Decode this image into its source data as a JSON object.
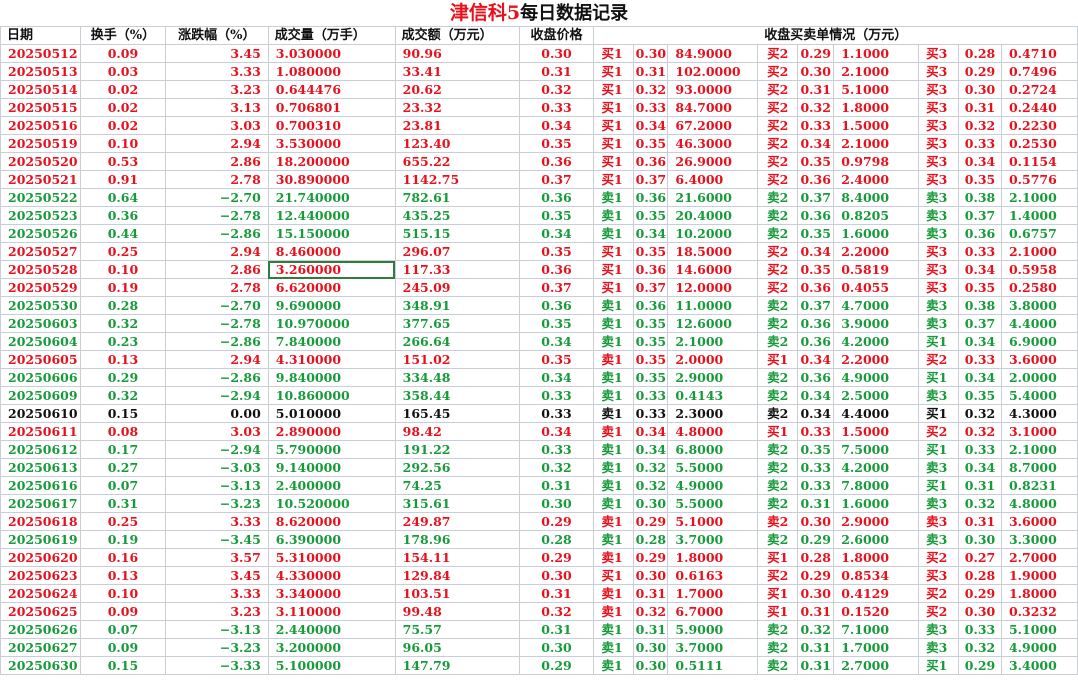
{
  "title": {
    "brand": "津信科5",
    "rest": "每日数据记录"
  },
  "headers": {
    "date": "日期",
    "turnover": "换手（%）",
    "change": "涨跌幅（%）",
    "volume": "成交量（万手）",
    "amount": "成交额（万元）",
    "close": "收盘价格",
    "orders": "收盘买卖单情况（万元）"
  },
  "colors": {
    "up": "#e8101c",
    "down": "#169a3a",
    "flat": "#111111",
    "grid": "#c9ced6"
  },
  "rows": [
    {
      "d": "20250512",
      "t": "0.09",
      "c": "3.45",
      "v": "3.030000",
      "a": "90.96",
      "p": "0.30",
      "s": "up",
      "o": [
        [
          "买1",
          "0.30",
          "84.9000"
        ],
        [
          "买2",
          "0.29",
          "1.1000"
        ],
        [
          "买3",
          "0.28",
          "0.4710"
        ]
      ]
    },
    {
      "d": "20250513",
      "t": "0.03",
      "c": "3.33",
      "v": "1.080000",
      "a": "33.41",
      "p": "0.31",
      "s": "up",
      "o": [
        [
          "买1",
          "0.31",
          "102.0000"
        ],
        [
          "买2",
          "0.30",
          "2.1000"
        ],
        [
          "买3",
          "0.29",
          "0.7496"
        ]
      ]
    },
    {
      "d": "20250514",
      "t": "0.02",
      "c": "3.23",
      "v": "0.644476",
      "a": "20.62",
      "p": "0.32",
      "s": "up",
      "o": [
        [
          "买1",
          "0.32",
          "93.0000"
        ],
        [
          "买2",
          "0.31",
          "5.1000"
        ],
        [
          "买3",
          "0.30",
          "0.2724"
        ]
      ]
    },
    {
      "d": "20250515",
      "t": "0.02",
      "c": "3.13",
      "v": "0.706801",
      "a": "23.32",
      "p": "0.33",
      "s": "up",
      "o": [
        [
          "买1",
          "0.33",
          "84.7000"
        ],
        [
          "买2",
          "0.32",
          "1.8000"
        ],
        [
          "买3",
          "0.31",
          "0.2440"
        ]
      ]
    },
    {
      "d": "20250516",
      "t": "0.02",
      "c": "3.03",
      "v": "0.700310",
      "a": "23.81",
      "p": "0.34",
      "s": "up",
      "o": [
        [
          "买1",
          "0.34",
          "67.2000"
        ],
        [
          "买2",
          "0.33",
          "1.5000"
        ],
        [
          "买3",
          "0.32",
          "0.2230"
        ]
      ]
    },
    {
      "d": "20250519",
      "t": "0.10",
      "c": "2.94",
      "v": "3.530000",
      "a": "123.40",
      "p": "0.35",
      "s": "up",
      "o": [
        [
          "买1",
          "0.35",
          "46.3000"
        ],
        [
          "买2",
          "0.34",
          "2.1000"
        ],
        [
          "买3",
          "0.33",
          "0.2530"
        ]
      ]
    },
    {
      "d": "20250520",
      "t": "0.53",
      "c": "2.86",
      "v": "18.200000",
      "a": "655.22",
      "p": "0.36",
      "s": "up",
      "o": [
        [
          "买1",
          "0.36",
          "26.9000"
        ],
        [
          "买2",
          "0.35",
          "0.9798"
        ],
        [
          "买3",
          "0.34",
          "0.1154"
        ]
      ]
    },
    {
      "d": "20250521",
      "t": "0.91",
      "c": "2.78",
      "v": "30.890000",
      "a": "1142.75",
      "p": "0.37",
      "s": "up",
      "o": [
        [
          "买1",
          "0.37",
          "6.4000"
        ],
        [
          "买2",
          "0.36",
          "2.4000"
        ],
        [
          "买3",
          "0.35",
          "0.5776"
        ]
      ]
    },
    {
      "d": "20250522",
      "t": "0.64",
      "c": "−2.70",
      "v": "21.740000",
      "a": "782.61",
      "p": "0.36",
      "s": "down",
      "o": [
        [
          "卖1",
          "0.36",
          "21.6000"
        ],
        [
          "卖2",
          "0.37",
          "8.4000"
        ],
        [
          "卖3",
          "0.38",
          "2.1000"
        ]
      ]
    },
    {
      "d": "20250523",
      "t": "0.36",
      "c": "−2.78",
      "v": "12.440000",
      "a": "435.25",
      "p": "0.35",
      "s": "down",
      "o": [
        [
          "卖1",
          "0.35",
          "20.4000"
        ],
        [
          "卖2",
          "0.36",
          "0.8205"
        ],
        [
          "卖3",
          "0.37",
          "1.4000"
        ]
      ]
    },
    {
      "d": "20250526",
      "t": "0.44",
      "c": "−2.86",
      "v": "15.150000",
      "a": "515.15",
      "p": "0.34",
      "s": "down",
      "o": [
        [
          "卖1",
          "0.34",
          "10.2000"
        ],
        [
          "卖2",
          "0.35",
          "1.6000"
        ],
        [
          "卖3",
          "0.36",
          "0.6757"
        ]
      ]
    },
    {
      "d": "20250527",
      "t": "0.25",
      "c": "2.94",
      "v": "8.460000",
      "a": "296.07",
      "p": "0.35",
      "s": "up",
      "o": [
        [
          "买1",
          "0.35",
          "18.5000"
        ],
        [
          "买2",
          "0.34",
          "2.2000"
        ],
        [
          "买3",
          "0.33",
          "2.1000"
        ]
      ]
    },
    {
      "d": "20250528",
      "t": "0.10",
      "c": "2.86",
      "v": "3.260000",
      "a": "117.33",
      "p": "0.36",
      "s": "up",
      "sel": true,
      "o": [
        [
          "买1",
          "0.36",
          "14.6000"
        ],
        [
          "买2",
          "0.35",
          "0.5819"
        ],
        [
          "买3",
          "0.34",
          "0.5958"
        ]
      ]
    },
    {
      "d": "20250529",
      "t": "0.19",
      "c": "2.78",
      "v": "6.620000",
      "a": "245.09",
      "p": "0.37",
      "s": "up",
      "o": [
        [
          "买1",
          "0.37",
          "12.0000"
        ],
        [
          "买2",
          "0.36",
          "0.4055"
        ],
        [
          "买3",
          "0.35",
          "0.2580"
        ]
      ]
    },
    {
      "d": "20250530",
      "t": "0.28",
      "c": "−2.70",
      "v": "9.690000",
      "a": "348.91",
      "p": "0.36",
      "s": "down",
      "o": [
        [
          "卖1",
          "0.36",
          "11.0000"
        ],
        [
          "卖2",
          "0.37",
          "4.7000"
        ],
        [
          "卖3",
          "0.38",
          "3.8000"
        ]
      ]
    },
    {
      "d": "20250603",
      "t": "0.32",
      "c": "−2.78",
      "v": "10.970000",
      "a": "377.65",
      "p": "0.35",
      "s": "down",
      "o": [
        [
          "卖1",
          "0.35",
          "12.6000"
        ],
        [
          "卖2",
          "0.36",
          "3.9000"
        ],
        [
          "卖3",
          "0.37",
          "4.4000"
        ]
      ]
    },
    {
      "d": "20250604",
      "t": "0.23",
      "c": "−2.86",
      "v": "7.840000",
      "a": "266.64",
      "p": "0.34",
      "s": "down",
      "o": [
        [
          "卖1",
          "0.35",
          "2.1000"
        ],
        [
          "卖2",
          "0.36",
          "4.2000"
        ],
        [
          "买1",
          "0.34",
          "6.9000"
        ]
      ]
    },
    {
      "d": "20250605",
      "t": "0.13",
      "c": "2.94",
      "v": "4.310000",
      "a": "151.02",
      "p": "0.35",
      "s": "up",
      "o": [
        [
          "卖1",
          "0.35",
          "2.0000"
        ],
        [
          "买1",
          "0.34",
          "2.2000"
        ],
        [
          "买2",
          "0.33",
          "3.6000"
        ]
      ]
    },
    {
      "d": "20250606",
      "t": "0.29",
      "c": "−2.86",
      "v": "9.840000",
      "a": "334.48",
      "p": "0.34",
      "s": "down",
      "o": [
        [
          "卖1",
          "0.35",
          "2.9000"
        ],
        [
          "卖2",
          "0.36",
          "4.9000"
        ],
        [
          "买1",
          "0.34",
          "2.0000"
        ]
      ]
    },
    {
      "d": "20250609",
      "t": "0.32",
      "c": "−2.94",
      "v": "10.860000",
      "a": "358.44",
      "p": "0.33",
      "s": "down",
      "o": [
        [
          "卖1",
          "0.33",
          "0.4143"
        ],
        [
          "卖2",
          "0.34",
          "2.5000"
        ],
        [
          "卖3",
          "0.35",
          "5.4000"
        ]
      ]
    },
    {
      "d": "20250610",
      "t": "0.15",
      "c": "0.00",
      "v": "5.010000",
      "a": "165.45",
      "p": "0.33",
      "s": "flat",
      "o": [
        [
          "卖1",
          "0.33",
          "2.3000"
        ],
        [
          "卖2",
          "0.34",
          "4.4000"
        ],
        [
          "买1",
          "0.32",
          "4.3000"
        ]
      ]
    },
    {
      "d": "20250611",
      "t": "0.08",
      "c": "3.03",
      "v": "2.890000",
      "a": "98.42",
      "p": "0.34",
      "s": "up",
      "o": [
        [
          "卖1",
          "0.34",
          "4.8000"
        ],
        [
          "买1",
          "0.33",
          "1.5000"
        ],
        [
          "买2",
          "0.32",
          "3.1000"
        ]
      ]
    },
    {
      "d": "20250612",
      "t": "0.17",
      "c": "−2.94",
      "v": "5.790000",
      "a": "191.22",
      "p": "0.33",
      "s": "down",
      "o": [
        [
          "卖1",
          "0.34",
          "6.8000"
        ],
        [
          "卖2",
          "0.35",
          "7.5000"
        ],
        [
          "买1",
          "0.33",
          "2.1000"
        ]
      ]
    },
    {
      "d": "20250613",
      "t": "0.27",
      "c": "−3.03",
      "v": "9.140000",
      "a": "292.56",
      "p": "0.32",
      "s": "down",
      "o": [
        [
          "卖1",
          "0.32",
          "5.5000"
        ],
        [
          "卖2",
          "0.33",
          "4.2000"
        ],
        [
          "卖3",
          "0.34",
          "8.7000"
        ]
      ]
    },
    {
      "d": "20250616",
      "t": "0.07",
      "c": "−3.13",
      "v": "2.400000",
      "a": "74.25",
      "p": "0.31",
      "s": "down",
      "o": [
        [
          "卖1",
          "0.32",
          "4.9000"
        ],
        [
          "卖2",
          "0.33",
          "7.8000"
        ],
        [
          "买1",
          "0.31",
          "0.8231"
        ]
      ]
    },
    {
      "d": "20250617",
      "t": "0.31",
      "c": "−3.23",
      "v": "10.520000",
      "a": "315.61",
      "p": "0.30",
      "s": "down",
      "o": [
        [
          "卖1",
          "0.30",
          "5.5000"
        ],
        [
          "卖2",
          "0.31",
          "1.6000"
        ],
        [
          "卖3",
          "0.32",
          "4.8000"
        ]
      ]
    },
    {
      "d": "20250618",
      "t": "0.25",
      "c": "3.33",
      "v": "8.620000",
      "a": "249.87",
      "p": "0.29",
      "s": "up",
      "o": [
        [
          "卖1",
          "0.29",
          "5.1000"
        ],
        [
          "卖2",
          "0.30",
          "2.9000"
        ],
        [
          "卖3",
          "0.31",
          "3.6000"
        ]
      ]
    },
    {
      "d": "20250619",
      "t": "0.19",
      "c": "−3.45",
      "v": "6.390000",
      "a": "178.96",
      "p": "0.28",
      "s": "down",
      "o": [
        [
          "卖1",
          "0.28",
          "3.7000"
        ],
        [
          "卖2",
          "0.29",
          "2.6000"
        ],
        [
          "卖3",
          "0.30",
          "3.3000"
        ]
      ]
    },
    {
      "d": "20250620",
      "t": "0.16",
      "c": "3.57",
      "v": "5.310000",
      "a": "154.11",
      "p": "0.29",
      "s": "up",
      "o": [
        [
          "卖1",
          "0.29",
          "1.8000"
        ],
        [
          "买1",
          "0.28",
          "1.8000"
        ],
        [
          "买2",
          "0.27",
          "2.7000"
        ]
      ]
    },
    {
      "d": "20250623",
      "t": "0.13",
      "c": "3.45",
      "v": "4.330000",
      "a": "129.84",
      "p": "0.30",
      "s": "up",
      "o": [
        [
          "买1",
          "0.30",
          "0.6163"
        ],
        [
          "买2",
          "0.29",
          "0.8534"
        ],
        [
          "买3",
          "0.28",
          "1.9000"
        ]
      ]
    },
    {
      "d": "20250624",
      "t": "0.10",
      "c": "3.33",
      "v": "3.340000",
      "a": "103.51",
      "p": "0.31",
      "s": "up",
      "o": [
        [
          "卖1",
          "0.31",
          "1.7000"
        ],
        [
          "买1",
          "0.30",
          "0.4129"
        ],
        [
          "买2",
          "0.29",
          "1.8000"
        ]
      ]
    },
    {
      "d": "20250625",
      "t": "0.09",
      "c": "3.23",
      "v": "3.110000",
      "a": "99.48",
      "p": "0.32",
      "s": "up",
      "o": [
        [
          "卖1",
          "0.32",
          "6.7000"
        ],
        [
          "买1",
          "0.31",
          "0.1520"
        ],
        [
          "买2",
          "0.30",
          "0.3232"
        ]
      ]
    },
    {
      "d": "20250626",
      "t": "0.07",
      "c": "−3.13",
      "v": "2.440000",
      "a": "75.57",
      "p": "0.31",
      "s": "down",
      "o": [
        [
          "卖1",
          "0.31",
          "5.9000"
        ],
        [
          "卖2",
          "0.32",
          "7.1000"
        ],
        [
          "卖3",
          "0.33",
          "5.1000"
        ]
      ]
    },
    {
      "d": "20250627",
      "t": "0.09",
      "c": "−3.23",
      "v": "3.200000",
      "a": "96.05",
      "p": "0.30",
      "s": "down",
      "o": [
        [
          "卖1",
          "0.30",
          "3.7000"
        ],
        [
          "卖2",
          "0.31",
          "1.7000"
        ],
        [
          "卖3",
          "0.32",
          "4.9000"
        ]
      ]
    },
    {
      "d": "20250630",
      "t": "0.15",
      "c": "−3.33",
      "v": "5.100000",
      "a": "147.79",
      "p": "0.29",
      "s": "down",
      "o": [
        [
          "卖1",
          "0.30",
          "0.5111"
        ],
        [
          "卖2",
          "0.31",
          "2.7000"
        ],
        [
          "买1",
          "0.29",
          "3.4000"
        ]
      ]
    }
  ]
}
